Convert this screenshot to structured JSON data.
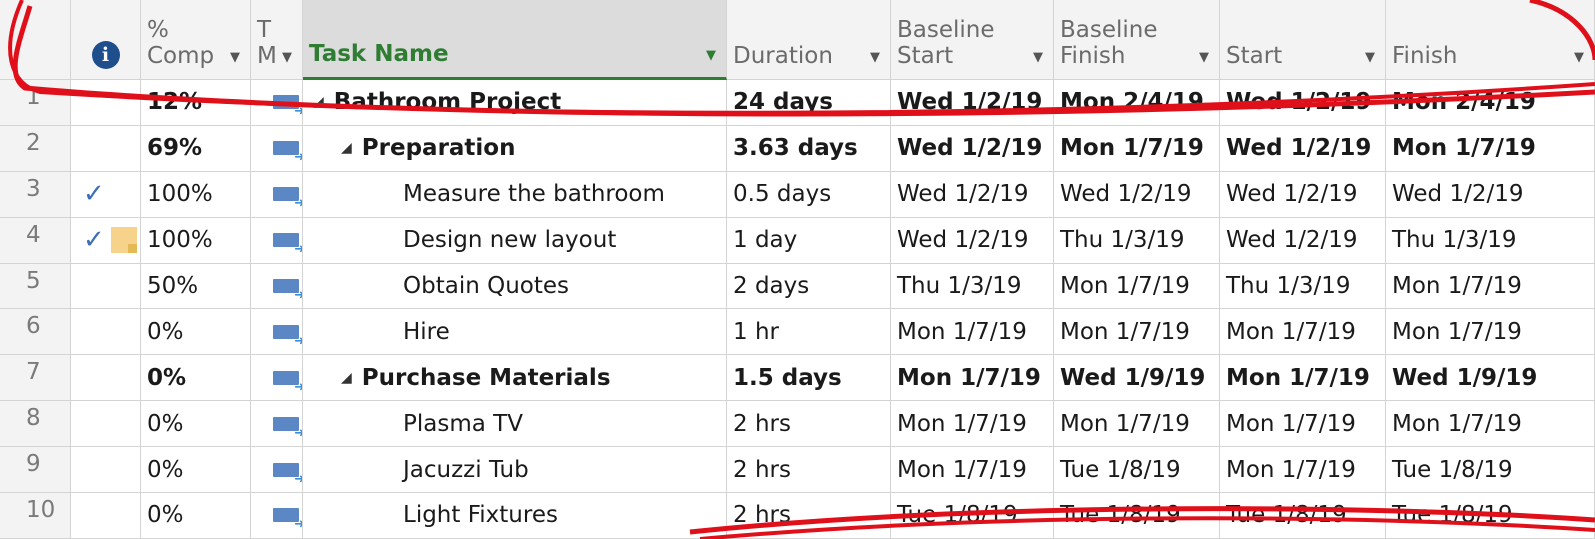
{
  "columns": {
    "info_icon": "info-icon",
    "pct_comp": [
      "%",
      "Comp"
    ],
    "mode": [
      "T",
      "M"
    ],
    "task_name": "Task Name",
    "duration": "Duration",
    "baseline_start": [
      "Baseline",
      "Start"
    ],
    "baseline_finish": [
      "Baseline",
      "Finish"
    ],
    "start": "Start",
    "finish": "Finish"
  },
  "rows": [
    {
      "id": "1",
      "check": false,
      "note": false,
      "pct": "12%",
      "name": "Bathroom Project",
      "level": 0,
      "summary": true,
      "duration": "24 days",
      "bstart": "Wed 1/2/19",
      "bfinish": "Mon 2/4/19",
      "start": "Wed 1/2/19",
      "finish": "Mon 2/4/19"
    },
    {
      "id": "2",
      "check": false,
      "note": false,
      "pct": "69%",
      "name": "Preparation",
      "level": 1,
      "summary": true,
      "duration": "3.63 days",
      "bstart": "Wed 1/2/19",
      "bfinish": "Mon 1/7/19",
      "start": "Wed 1/2/19",
      "finish": "Mon 1/7/19"
    },
    {
      "id": "3",
      "check": true,
      "note": false,
      "pct": "100%",
      "name": "Measure the bathroom",
      "level": 2,
      "summary": false,
      "duration": "0.5 days",
      "bstart": "Wed 1/2/19",
      "bfinish": "Wed 1/2/19",
      "start": "Wed 1/2/19",
      "finish": "Wed 1/2/19"
    },
    {
      "id": "4",
      "check": true,
      "note": true,
      "pct": "100%",
      "name": "Design new layout",
      "level": 2,
      "summary": false,
      "duration": "1 day",
      "bstart": "Wed 1/2/19",
      "bfinish": "Thu 1/3/19",
      "start": "Wed 1/2/19",
      "finish": "Thu 1/3/19"
    },
    {
      "id": "5",
      "check": false,
      "note": false,
      "pct": "50%",
      "name": "Obtain Quotes",
      "level": 2,
      "summary": false,
      "duration": "2 days",
      "bstart": "Thu 1/3/19",
      "bfinish": "Mon 1/7/19",
      "start": "Thu 1/3/19",
      "finish": "Mon 1/7/19"
    },
    {
      "id": "6",
      "check": false,
      "note": false,
      "pct": "0%",
      "name": "Hire",
      "level": 2,
      "summary": false,
      "duration": "1 hr",
      "bstart": "Mon 1/7/19",
      "bfinish": "Mon 1/7/19",
      "start": "Mon 1/7/19",
      "finish": "Mon 1/7/19"
    },
    {
      "id": "7",
      "check": false,
      "note": false,
      "pct": "0%",
      "name": "Purchase Materials",
      "level": 1,
      "summary": true,
      "duration": "1.5 days",
      "bstart": "Mon 1/7/19",
      "bfinish": "Wed 1/9/19",
      "start": "Mon 1/7/19",
      "finish": "Wed 1/9/19"
    },
    {
      "id": "8",
      "check": false,
      "note": false,
      "pct": "0%",
      "name": "Plasma TV",
      "level": 2,
      "summary": false,
      "duration": "2 hrs",
      "bstart": "Mon 1/7/19",
      "bfinish": "Mon 1/7/19",
      "start": "Mon 1/7/19",
      "finish": "Mon 1/7/19"
    },
    {
      "id": "9",
      "check": false,
      "note": false,
      "pct": "0%",
      "name": "Jacuzzi Tub",
      "level": 2,
      "summary": false,
      "duration": "2 hrs",
      "bstart": "Mon 1/7/19",
      "bfinish": "Tue 1/8/19",
      "start": "Mon 1/7/19",
      "finish": "Tue 1/8/19"
    },
    {
      "id": "10",
      "check": false,
      "note": false,
      "pct": "0%",
      "name": "Light Fixtures",
      "level": 2,
      "summary": false,
      "duration": "2 hrs",
      "bstart": "Tue 1/8/19",
      "bfinish": "Tue 1/8/19",
      "start": "Tue 1/8/19",
      "finish": "Tue 1/8/19"
    }
  ],
  "colors": {
    "task_header_text": "#2e7d32",
    "annotation_red": "#e0101b",
    "mode_icon": "#5b87c5",
    "checkmark": "#3b6fb6"
  }
}
